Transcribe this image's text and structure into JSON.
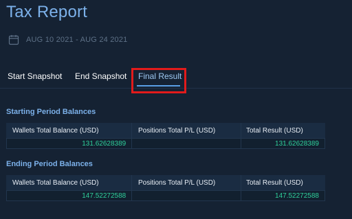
{
  "header": {
    "title": "Tax Report"
  },
  "date_range": {
    "icon": "calendar-icon",
    "text": "AUG 10 2021 - AUG 24 2021"
  },
  "tabs": [
    {
      "label": "Start Snapshot",
      "active": false
    },
    {
      "label": "End Snapshot",
      "active": false
    },
    {
      "label": "Final Result",
      "active": true
    }
  ],
  "starting": {
    "title": "Starting Period Balances",
    "columns": [
      "Wallets Total Balance (USD)",
      "Positions Total P/L (USD)",
      "Total Result (USD)"
    ],
    "values": [
      "131.62628389",
      "",
      "131.62628389"
    ]
  },
  "ending": {
    "title": "Ending Period Balances",
    "columns": [
      "Wallets Total Balance (USD)",
      "Positions Total P/L (USD)",
      "Total Result (USD)"
    ],
    "values": [
      "147.52272588",
      "",
      "147.52272588"
    ]
  },
  "colors": {
    "accent": "#7cb1ea",
    "positive": "#2fcf9a",
    "highlight": "#e21b1b",
    "background": "#152233"
  }
}
